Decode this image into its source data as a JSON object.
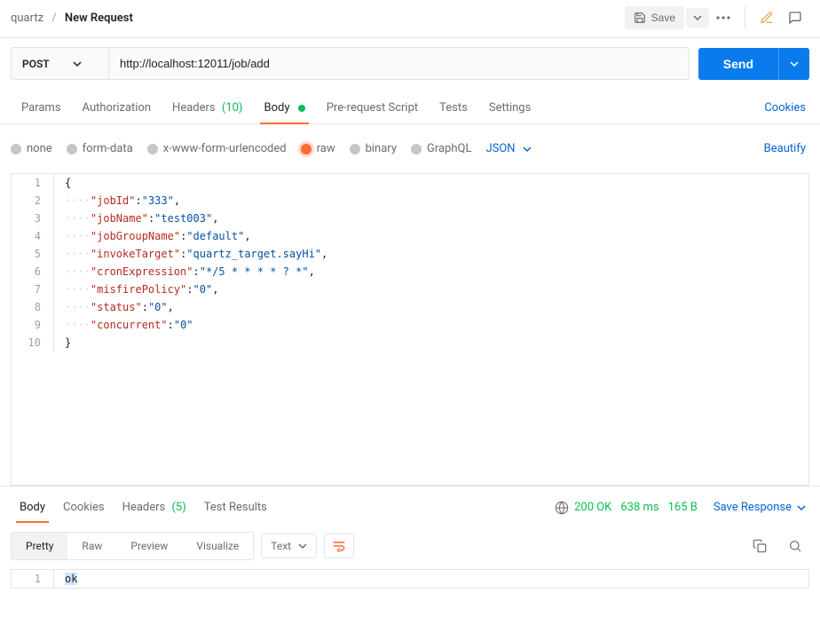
{
  "breadcrumb": {
    "folder": "quartz",
    "separator": "/",
    "name": "New Request"
  },
  "toolbar": {
    "save_label": "Save"
  },
  "request": {
    "method": "POST",
    "url": "http://localhost:12011/job/add",
    "send_label": "Send"
  },
  "tabs": {
    "params": "Params",
    "authorization": "Authorization",
    "headers": "Headers",
    "headers_count": "(10)",
    "body": "Body",
    "pre_request": "Pre-request Script",
    "tests": "Tests",
    "settings": "Settings",
    "cookies_link": "Cookies"
  },
  "body_type": {
    "none": "none",
    "form_data": "form-data",
    "x_www": "x-www-form-urlencoded",
    "raw": "raw",
    "binary": "binary",
    "graphql": "GraphQL",
    "raw_lang": "JSON",
    "beautify": "Beautify"
  },
  "editor": {
    "lines": [
      {
        "n": "1",
        "indent": 0,
        "tokens": [
          {
            "t": "p",
            "v": "{"
          }
        ]
      },
      {
        "n": "2",
        "indent": 1,
        "tokens": [
          {
            "t": "k",
            "v": "\"jobId\""
          },
          {
            "t": "p",
            "v": ":"
          },
          {
            "t": "s",
            "v": "\"333\""
          },
          {
            "t": "p",
            "v": ","
          }
        ]
      },
      {
        "n": "3",
        "indent": 1,
        "tokens": [
          {
            "t": "k",
            "v": "\"jobName\""
          },
          {
            "t": "p",
            "v": ":"
          },
          {
            "t": "s",
            "v": "\"test003\""
          },
          {
            "t": "p",
            "v": ","
          }
        ]
      },
      {
        "n": "4",
        "indent": 1,
        "tokens": [
          {
            "t": "k",
            "v": "\"jobGroupName\""
          },
          {
            "t": "p",
            "v": ":"
          },
          {
            "t": "s",
            "v": "\"default\""
          },
          {
            "t": "p",
            "v": ","
          }
        ]
      },
      {
        "n": "5",
        "indent": 1,
        "tokens": [
          {
            "t": "k",
            "v": "\"invokeTarget\""
          },
          {
            "t": "p",
            "v": ":"
          },
          {
            "t": "s",
            "v": "\"quartz_target.sayHi\""
          },
          {
            "t": "p",
            "v": ","
          }
        ]
      },
      {
        "n": "6",
        "indent": 1,
        "tokens": [
          {
            "t": "k",
            "v": "\"cronExpression\""
          },
          {
            "t": "p",
            "v": ":"
          },
          {
            "t": "s",
            "v": "\"*/5 * * * * ? *\""
          },
          {
            "t": "p",
            "v": ","
          }
        ]
      },
      {
        "n": "7",
        "indent": 1,
        "tokens": [
          {
            "t": "k",
            "v": "\"misfirePolicy\""
          },
          {
            "t": "p",
            "v": ":"
          },
          {
            "t": "s",
            "v": "\"0\""
          },
          {
            "t": "p",
            "v": ","
          }
        ]
      },
      {
        "n": "8",
        "indent": 1,
        "tokens": [
          {
            "t": "k",
            "v": "\"status\""
          },
          {
            "t": "p",
            "v": ":"
          },
          {
            "t": "s",
            "v": "\"0\""
          },
          {
            "t": "p",
            "v": ","
          }
        ]
      },
      {
        "n": "9",
        "indent": 1,
        "tokens": [
          {
            "t": "k",
            "v": "\"concurrent\""
          },
          {
            "t": "p",
            "v": ":"
          },
          {
            "t": "s",
            "v": "\"0\""
          }
        ]
      },
      {
        "n": "10",
        "indent": 0,
        "tokens": [
          {
            "t": "p",
            "v": "}"
          }
        ]
      }
    ]
  },
  "response": {
    "tabs": {
      "body": "Body",
      "cookies": "Cookies",
      "headers": "Headers",
      "headers_count": "(5)",
      "test_results": "Test Results"
    },
    "status": "200 OK",
    "time": "638 ms",
    "size": "165 B",
    "save_link": "Save Response",
    "view_tabs": {
      "pretty": "Pretty",
      "raw": "Raw",
      "preview": "Preview",
      "visualize": "Visualize"
    },
    "format_label": "Text",
    "body_lines": [
      {
        "n": "1",
        "text": "ok"
      }
    ]
  }
}
